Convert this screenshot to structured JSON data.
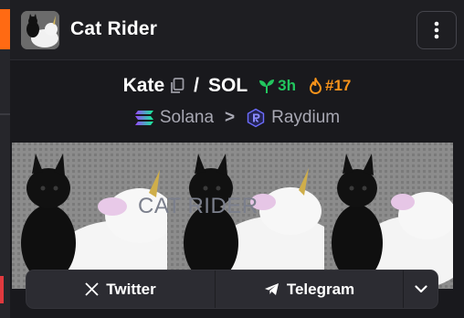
{
  "header": {
    "title": "Cat Rider",
    "avatar_icon": "cat-unicorn-avatar",
    "menu_icon": "kebab-menu-icon"
  },
  "pair": {
    "base_token": "Kate",
    "separator": "/",
    "quote_token": "SOL",
    "copy_icon": "copy-icon",
    "age": "3h",
    "age_icon": "seedling-icon",
    "rank": "#17",
    "rank_icon": "flame-icon"
  },
  "chain": {
    "network": "Solana",
    "network_icon": "solana-icon",
    "arrow": ">",
    "dex": "Raydium",
    "dex_icon": "raydium-icon"
  },
  "banner": {
    "text": "CAT RIDER"
  },
  "socials": {
    "twitter_label": "Twitter",
    "twitter_icon": "x-icon",
    "telegram_label": "Telegram",
    "telegram_icon": "telegram-icon",
    "more_icon": "chevron-down-icon"
  },
  "colors": {
    "accent_orange": "#ff6a13",
    "age_green": "#22c55e",
    "rank_orange": "#f7931a",
    "muted_text": "#a8a8b3",
    "panel_bg": "#19191d"
  }
}
